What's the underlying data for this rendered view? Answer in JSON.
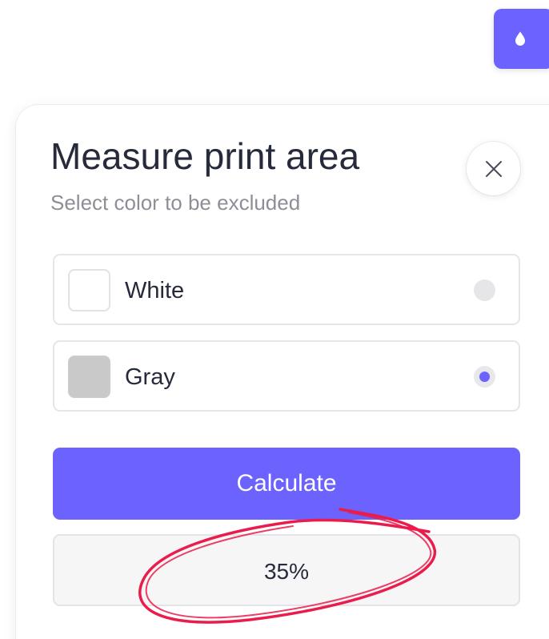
{
  "app": {
    "fab_icon": "droplet-icon"
  },
  "dialog": {
    "title": "Measure print area",
    "subtitle": "Select color to be excluded",
    "close_icon": "close-icon",
    "options": [
      {
        "label": "White",
        "swatch_color": "#ffffff",
        "selected": false
      },
      {
        "label": "Gray",
        "swatch_color": "#c9c9c9",
        "selected": true
      }
    ],
    "calculate_label": "Calculate",
    "result": "35%"
  },
  "annotation": {
    "type": "hand-drawn ellipse around result",
    "color": "#ea1c4b"
  },
  "colors": {
    "accent": "#6c63ff",
    "text": "#262a3b",
    "muted": "#8d8f96",
    "border": "#e6e6ea"
  }
}
